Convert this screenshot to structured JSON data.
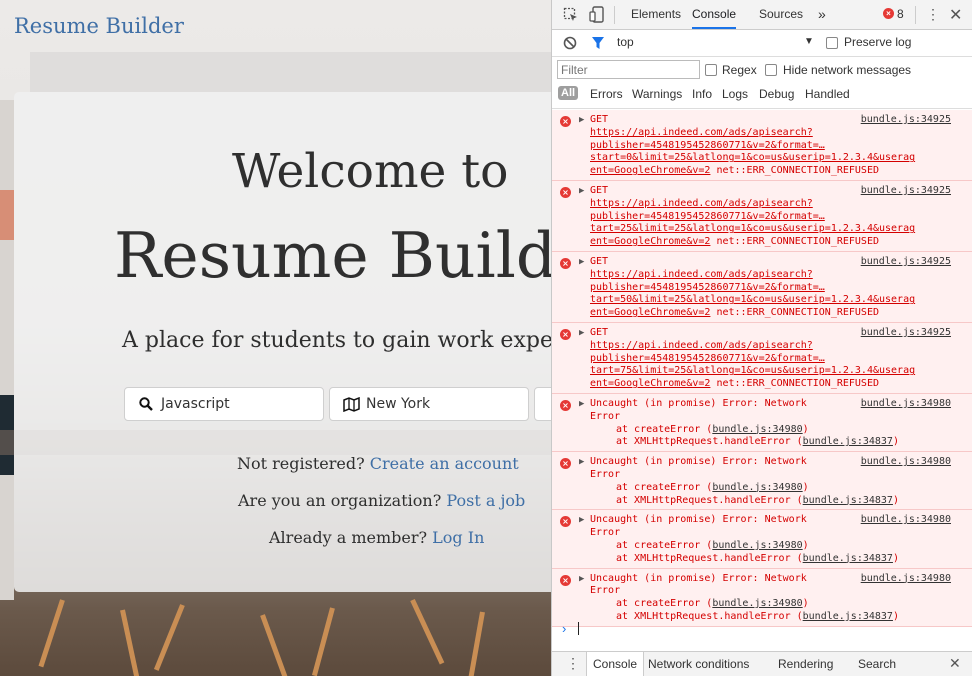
{
  "site": {
    "brand": "Resume Builder",
    "welcome_line1": "Welcome to",
    "welcome_line2": "Resume Build",
    "tagline": "A place for students to gain work experi",
    "search_keyword": "Javascript",
    "search_location": "New York",
    "not_registered": "Not registered?",
    "create_account": "Create an account",
    "organization": "Are you an organization?",
    "post_job": "Post a job",
    "already_member": "Already a member?",
    "log_in": "Log In"
  },
  "devtools": {
    "tabs": [
      "Elements",
      "Console",
      "Sources",
      "»"
    ],
    "error_count": "8",
    "context": "top",
    "preserve_log": "Preserve log",
    "filter_placeholder": "Filter",
    "regex": "Regex",
    "hide_network": "Hide network messages",
    "levels": [
      "All",
      "Errors",
      "Warnings",
      "Info",
      "Logs",
      "Debug",
      "Handled"
    ],
    "get_entries": [
      {
        "method": "GET",
        "url1": "https://api.indeed.com/ads/apisearch?",
        "url2": "publisher=4548195452860771&v=2&format=…",
        "url3": "start=0&limit=25&latlong=1&co=us&userip=1.2.3.4&userag",
        "url4": "ent=GoogleChrome&v=2",
        "err": " net::ERR_CONNECTION_REFUSED",
        "source": "bundle.js:34925"
      },
      {
        "method": "GET",
        "url1": "https://api.indeed.com/ads/apisearch?",
        "url2": "publisher=4548195452860771&v=2&format=…",
        "url3": "tart=25&limit=25&latlong=1&co=us&userip=1.2.3.4&userag",
        "url4": "ent=GoogleChrome&v=2",
        "err": " net::ERR_CONNECTION_REFUSED",
        "source": "bundle.js:34925"
      },
      {
        "method": "GET",
        "url1": "https://api.indeed.com/ads/apisearch?",
        "url2": "publisher=4548195452860771&v=2&format=…",
        "url3": "tart=50&limit=25&latlong=1&co=us&userip=1.2.3.4&userag",
        "url4": "ent=GoogleChrome&v=2",
        "err": " net::ERR_CONNECTION_REFUSED",
        "source": "bundle.js:34925"
      },
      {
        "method": "GET",
        "url1": "https://api.indeed.com/ads/apisearch?",
        "url2": "publisher=4548195452860771&v=2&format=…",
        "url3": "tart=75&limit=25&latlong=1&co=us&userip=1.2.3.4&userag",
        "url4": "ent=GoogleChrome&v=2",
        "err": " net::ERR_CONNECTION_REFUSED",
        "source": "bundle.js:34925"
      }
    ],
    "promise_entries": [
      {
        "msg1": "Uncaught (in promise) Error: Network",
        "msg2": "Error",
        "at1_pre": "at createError (",
        "at1_src": "bundle.js:34980",
        "at1_post": ")",
        "at2_pre": "at XMLHttpRequest.handleError (",
        "at2_src": "bundle.js:34837",
        "at2_post": ")",
        "source": "bundle.js:34980"
      },
      {
        "msg1": "Uncaught (in promise) Error: Network",
        "msg2": "Error",
        "at1_pre": "at createError (",
        "at1_src": "bundle.js:34980",
        "at1_post": ")",
        "at2_pre": "at XMLHttpRequest.handleError (",
        "at2_src": "bundle.js:34837",
        "at2_post": ")",
        "source": "bundle.js:34980"
      },
      {
        "msg1": "Uncaught (in promise) Error: Network",
        "msg2": "Error",
        "at1_pre": "at createError (",
        "at1_src": "bundle.js:34980",
        "at1_post": ")",
        "at2_pre": "at XMLHttpRequest.handleError (",
        "at2_src": "bundle.js:34837",
        "at2_post": ")",
        "source": "bundle.js:34980"
      },
      {
        "msg1": "Uncaught (in promise) Error: Network",
        "msg2": "Error",
        "at1_pre": "at createError (",
        "at1_src": "bundle.js:34980",
        "at1_post": ")",
        "at2_pre": "at XMLHttpRequest.handleError (",
        "at2_src": "bundle.js:34837",
        "at2_post": ")",
        "source": "bundle.js:34980"
      }
    ],
    "drawer_tabs": [
      "Console",
      "Network conditions",
      "Rendering",
      "Search"
    ],
    "colors": {
      "accent": "#1a73e8",
      "error_text": "#d40000",
      "error_bg": "#fff0f0",
      "link": "#3f6fa6"
    }
  }
}
